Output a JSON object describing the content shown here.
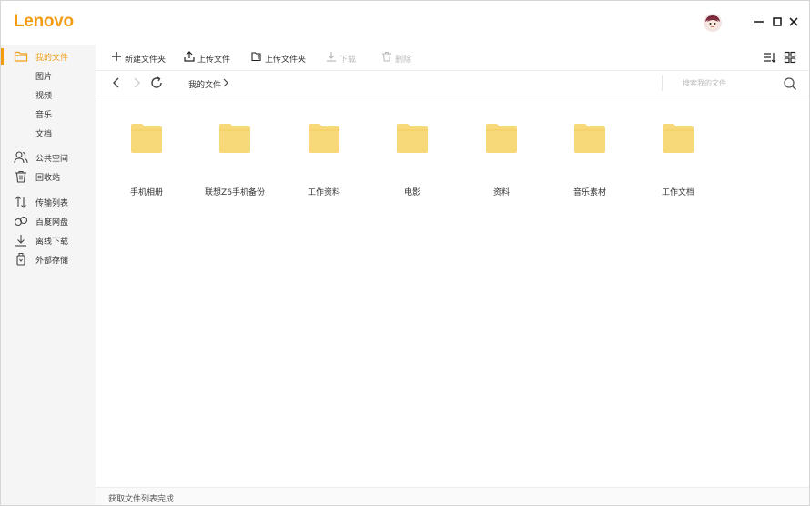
{
  "app": {
    "logo": "Lenovo"
  },
  "sidebar": {
    "items": [
      {
        "label": "我的文件",
        "active": true
      },
      {
        "label": "图片"
      },
      {
        "label": "视频"
      },
      {
        "label": "音乐"
      },
      {
        "label": "文档"
      },
      {
        "label": "公共空间"
      },
      {
        "label": "回收站"
      },
      {
        "label": "传输列表"
      },
      {
        "label": "百度网盘"
      },
      {
        "label": "离线下载"
      },
      {
        "label": "外部存储"
      }
    ]
  },
  "toolbar": {
    "new_folder": "新建文件夹",
    "upload_file": "上传文件",
    "upload_folder": "上传文件夹",
    "download": "下载",
    "delete": "删除"
  },
  "navbar": {
    "breadcrumb": "我的文件",
    "search_placeholder": "搜索我的文件"
  },
  "files": [
    {
      "name": "手机相册"
    },
    {
      "name": "联想Z6手机备份"
    },
    {
      "name": "工作资料"
    },
    {
      "name": "电影"
    },
    {
      "name": "资料"
    },
    {
      "name": "音乐素材"
    },
    {
      "name": "工作文档"
    }
  ],
  "status": {
    "text": "获取文件列表完成"
  },
  "colors": {
    "accent": "#f39c12",
    "folder": "#f7d97a",
    "sidebar_bg": "#f5f5f5"
  }
}
